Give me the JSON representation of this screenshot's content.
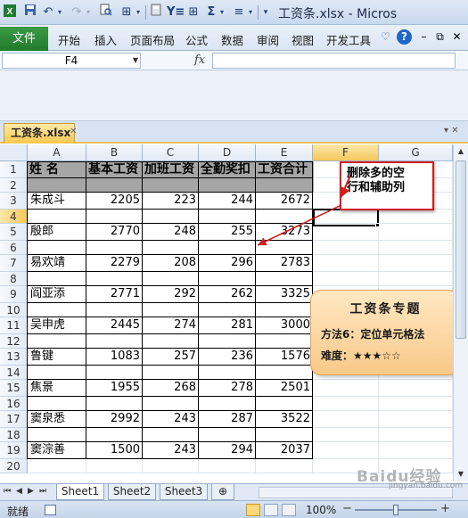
{
  "window": {
    "title": "工资条.xlsx - Micros",
    "qat": [
      "save-icon",
      "undo-icon",
      "redo-icon",
      "print-preview-icon",
      "layout-icon",
      "calculator-icon",
      "filter-icon",
      "table-icon",
      "autosum-icon",
      "align-icon"
    ]
  },
  "ribbon": {
    "file_tab": "文件",
    "tabs": [
      "开始",
      "插入",
      "页面布局",
      "公式",
      "数据",
      "审阅",
      "视图",
      "开发工具"
    ]
  },
  "formula_bar": {
    "name_box": "F4",
    "fx_label": "fx",
    "formula": ""
  },
  "workbook_tab": {
    "name": "工资条.xlsx"
  },
  "columns": [
    "A",
    "B",
    "C",
    "D",
    "E",
    "F",
    "G"
  ],
  "selected_column": "F",
  "selected_row": "4",
  "rows": [
    "1",
    "2",
    "3",
    "4",
    "5",
    "6",
    "7",
    "8",
    "9",
    "10",
    "11",
    "12",
    "13",
    "14",
    "15",
    "16",
    "17",
    "18",
    "19",
    "20"
  ],
  "table": {
    "headers": [
      "姓  名",
      "基本工资",
      "加班工资",
      "全勤奖扣",
      "工资合计"
    ],
    "records": [
      {
        "name": "朱成斗",
        "base": "2205",
        "overtime": "223",
        "attendance": "244",
        "total": "2672"
      },
      {
        "name": "殷郎",
        "base": "2770",
        "overtime": "248",
        "attendance": "255",
        "total": "3273"
      },
      {
        "name": "易欢靖",
        "base": "2279",
        "overtime": "208",
        "attendance": "296",
        "total": "2783"
      },
      {
        "name": "阎亚添",
        "base": "2771",
        "overtime": "292",
        "attendance": "262",
        "total": "3325"
      },
      {
        "name": "吴申虎",
        "base": "2445",
        "overtime": "274",
        "attendance": "281",
        "total": "3000"
      },
      {
        "name": "鲁键",
        "base": "1083",
        "overtime": "257",
        "attendance": "236",
        "total": "1576"
      },
      {
        "name": "焦景",
        "base": "1955",
        "overtime": "268",
        "attendance": "278",
        "total": "2501"
      },
      {
        "name": "窦泉悉",
        "base": "2992",
        "overtime": "243",
        "attendance": "287",
        "total": "3522"
      },
      {
        "name": "窦淙善",
        "base": "1500",
        "overtime": "243",
        "attendance": "294",
        "total": "2037"
      }
    ]
  },
  "callout": {
    "text_line1": "删除多的空",
    "text_line2": "行和辅助列"
  },
  "info_card": {
    "title": "工资条专题",
    "line1": "方法6：定位单元格法",
    "line2": "难度：★★★☆☆"
  },
  "sheets": {
    "tabs": [
      "Sheet1",
      "Sheet2",
      "Sheet3"
    ],
    "active": "Sheet1"
  },
  "status_bar": {
    "status": "就绪",
    "zoom": "100%",
    "zoom_value_percent": 100
  },
  "watermark": {
    "text": "Baidu经验",
    "sub": "jingyan.baidu.com"
  },
  "colors": {
    "file_tab": "#217a2b",
    "callout_border": "#d21e1e",
    "card_fill": "#f8c989",
    "header_fill": "#a6a6a6",
    "selection": "#f5c95c"
  }
}
